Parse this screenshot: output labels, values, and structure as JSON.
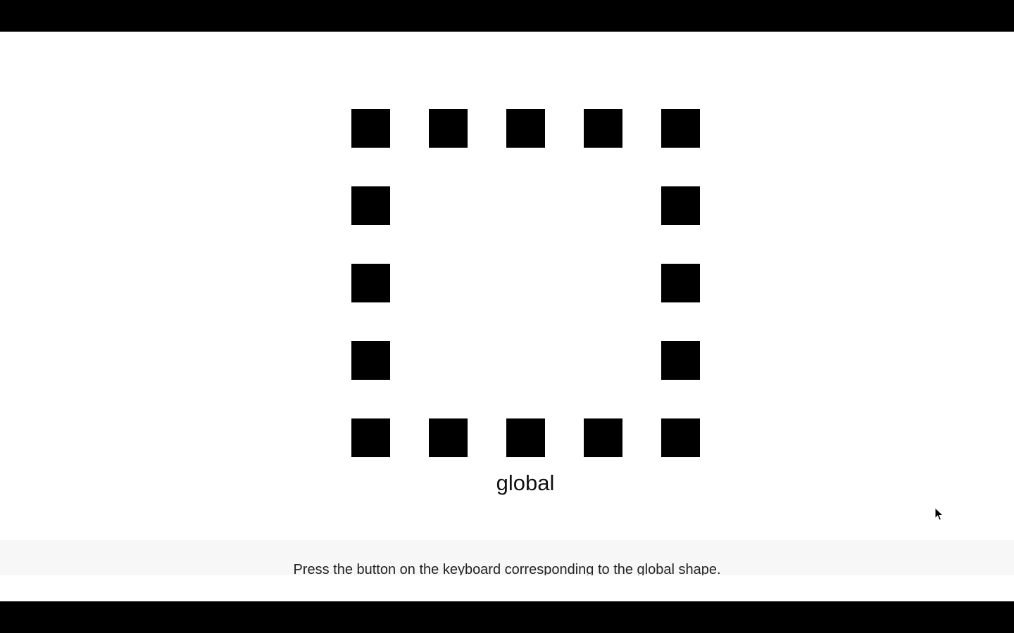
{
  "stimulus": {
    "label": "global",
    "fill_color": "#000000",
    "background_color": "#ffffff"
  },
  "instruction": {
    "text": "Press the button on the keyboard corresponding to the global shape."
  },
  "cursor": {
    "icon": "mouse-pointer-icon"
  }
}
